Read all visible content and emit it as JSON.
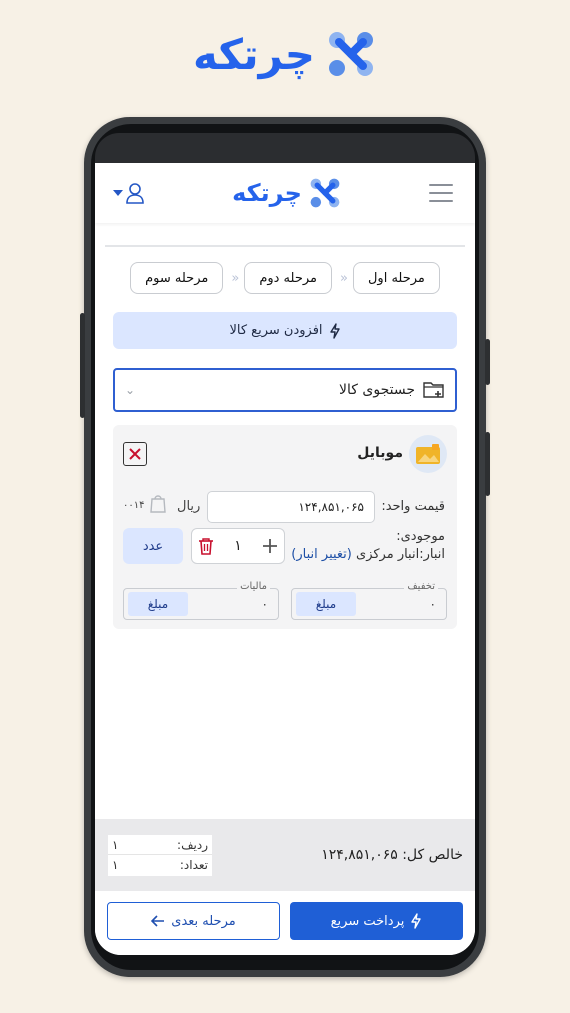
{
  "brand": {
    "name": "چرتکه"
  },
  "header": {
    "logo_text": "چرتکه"
  },
  "steps": [
    {
      "label": "مرحله اول"
    },
    {
      "label": "مرحله دوم"
    },
    {
      "label": "مرحله سوم"
    }
  ],
  "quick_add": {
    "label": "افزودن سریع کالا"
  },
  "search": {
    "placeholder": "جستجوی کالا"
  },
  "product": {
    "name": "موبایل",
    "unit_price_label": "قیمت واحد:",
    "unit_price": "۱۲۴,۸۵۱,۰۶۵",
    "currency": "ریال",
    "code": "۰۰۱۴",
    "stock_label": "موجودی:",
    "warehouse_label": "انبار:",
    "warehouse_name": "انبار مرکزی",
    "change_warehouse": "(تغییر انبار)",
    "quantity": "۱",
    "unit": "عدد",
    "discount": {
      "legend": "تخفیف",
      "value": "۰",
      "type": "مبلغ"
    },
    "tax": {
      "legend": "مالیات",
      "value": "۰",
      "type": "مبلغ"
    }
  },
  "summary": {
    "net_label": "خالص کل:",
    "net_value": "۱۲۴,۸۵۱,۰۶۵",
    "rows_label": "ردیف:",
    "rows_value": "۱",
    "count_label": "تعداد:",
    "count_value": "۱"
  },
  "actions": {
    "quick_pay": "پرداخت سریع",
    "next_step": "مرحله بعدی"
  },
  "colors": {
    "accent": "#2563eb",
    "primary_button": "#1f5fd6",
    "soft_blue": "#dbe6ff",
    "danger": "#c8102e"
  }
}
